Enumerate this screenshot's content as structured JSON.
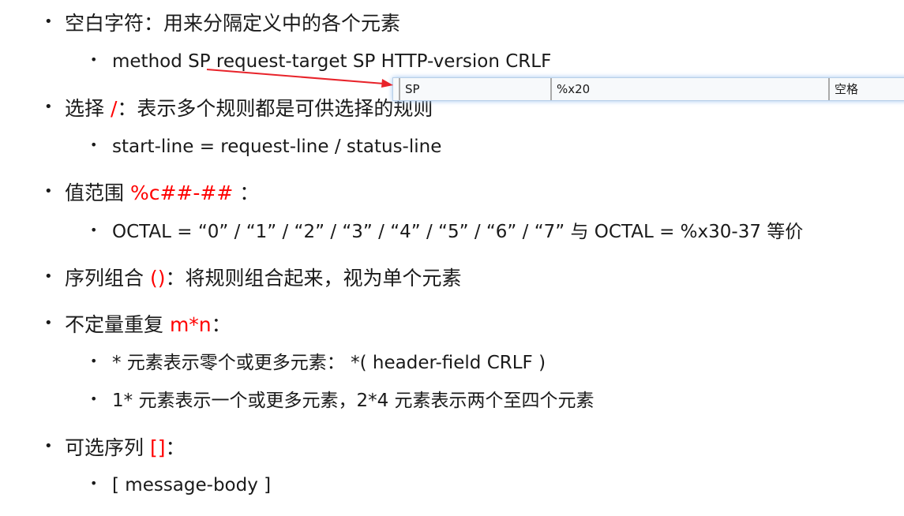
{
  "items": [
    {
      "level": 1,
      "text": "空白字符：用来分隔定义中的各个元素"
    },
    {
      "level": 2,
      "text": "method SP request-target SP HTTP-version CRLF"
    },
    {
      "level": 1,
      "pre": "选择 ",
      "red": "/",
      "post": "：表示多个规则都是可供选择的规则"
    },
    {
      "level": 2,
      "text": "start-line = request-line / status-line"
    },
    {
      "level": 1,
      "pre": "值范围 ",
      "red": "%c##-##",
      "post": " ："
    },
    {
      "level": 2,
      "text": "OCTAL = “0” / “1” / “2” / “3” / “4” / “5” / “6” / “7” 与 OCTAL = %x30-37 等价"
    },
    {
      "level": 1,
      "pre": "序列组合 ",
      "red": "()",
      "post": "：将规则组合起来，视为单个元素"
    },
    {
      "level": 1,
      "pre": "不定量重复 ",
      "red": "m*n",
      "post": "："
    },
    {
      "level": 2,
      "text": "* 元素表示零个或更多元素： *( header-field CRLF )"
    },
    {
      "level": 2,
      "text": "1* 元素表示一个或更多元素，2*4 元素表示两个至四个元素"
    },
    {
      "level": 1,
      "pre": "可选序列 ",
      "red": "[]",
      "post": "："
    },
    {
      "level": 2,
      "text": "[ message-body ]"
    }
  ],
  "bullet": "•",
  "popup": {
    "name": "SP",
    "value": "%x20",
    "description": "空格"
  },
  "colors": {
    "accent": "#ff0000",
    "arrow": "#e8232a"
  }
}
